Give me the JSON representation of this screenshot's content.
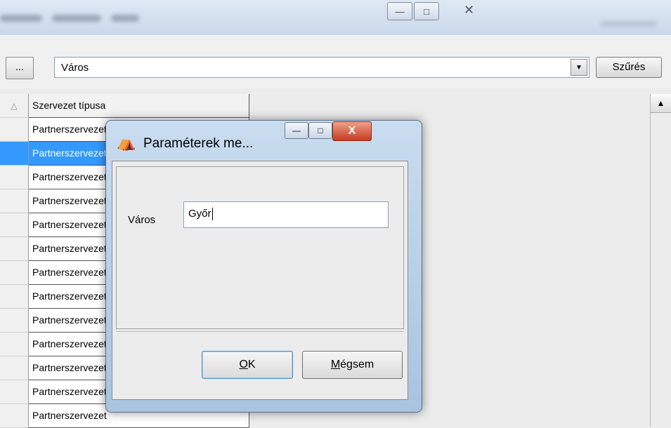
{
  "main_window": {
    "window_buttons": [
      "—",
      "□",
      "✕"
    ]
  },
  "toolbar": {
    "ellipsis_label": "...",
    "field_combo_value": "Város",
    "dropdown_arrow": "▼",
    "filter_label": "Szűrés"
  },
  "grid": {
    "sort_indicator": "△",
    "column_header": "Szervezet típusa",
    "rows": [
      "Partnerszervezet",
      "Partnerszervezet",
      "Partnerszervezet",
      "Partnerszervezet",
      "Partnerszervezet",
      "Partnerszervezet",
      "Partnerszervezet",
      "Partnerszervezet",
      "Partnerszervezet",
      "Partnerszervezet",
      "Partnerszervezet",
      "Partnerszervezet",
      "Partnerszervezet"
    ],
    "selected_row_index": 1,
    "scroll_up_arrow": "▲"
  },
  "dialog": {
    "title": "Paraméterek me...",
    "buttons": {
      "minimize": "—",
      "maximize": "□",
      "close": "X"
    },
    "field_label": "Város",
    "field_value": "Győr",
    "ok_label_underlined": "O",
    "ok_label_rest": "K",
    "cancel_label_underlined": "M",
    "cancel_label_rest": "égsem"
  },
  "colors": {
    "selection": "#3399ff",
    "dialog_frame": "#a9c4e0",
    "close_button": "#c63b22"
  }
}
